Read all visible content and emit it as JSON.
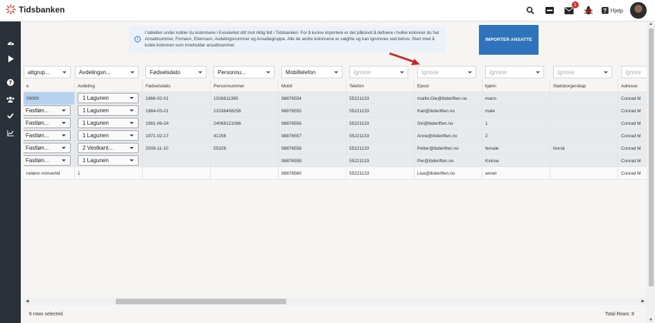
{
  "app": {
    "title": "Tidsbanken"
  },
  "topbar": {
    "help_label": "Hjelp",
    "mail_badge": "1"
  },
  "info": {
    "text": "I tabellen under kobler du kolonnene i Excelarket ditt mot riktig felt i Tidsbanken. For å kunne importere er det påkrevd å definere i hvilke kolonner du har Ansattnummer, Fornavn, Etternavn, Avdelingsnummer og Ansattegruppe. Alle de andre kolonnene er valgfrie og kan ignoreres ved behov. Start med å koble kolonnen som inneholder ansattnummer."
  },
  "import_button": {
    "label": "IMPORTER ANSATTE"
  },
  "column_selects": [
    {
      "label": "attgrup..."
    },
    {
      "label": "Avdelingsn..."
    },
    {
      "label": "Fødselsdato"
    },
    {
      "label": "Personnu..."
    },
    {
      "label": "Mobiltelefon"
    },
    {
      "label": "Ignorer"
    },
    {
      "label": "Ignorer"
    },
    {
      "label": "Ignorer"
    },
    {
      "label": "Ignorer"
    },
    {
      "label": "Ignore"
    }
  ],
  "headers": [
    "e",
    "Avdeling",
    "Fødselsdato",
    "Personnummer",
    "Mobil",
    "Telefon",
    "Epost",
    "kjønn",
    "Statsborgerskap",
    "Adresse"
  ],
  "rows": [
    {
      "c0": "00000",
      "c1": "",
      "c2": "1966-02-01",
      "c3": "1026611365",
      "c4": "98876554",
      "c5": "55221133",
      "c6": "mailto:Ole@ibderiften.no",
      "c7": "mann",
      "c8": "",
      "c9": "Conrad M"
    },
    {
      "c0": "Fastløn...",
      "c1": "1 Lagunen",
      "c2": "1984-03-21",
      "c3": "21038408256",
      "c4": "98876555",
      "c5": "55221133",
      "c6": "Kari@ibderiften.no",
      "c7": "male",
      "c8": "",
      "c9": "Conrad M"
    },
    {
      "c0": "Fastløn...",
      "c1": "1 Lagunen",
      "c2": "1981-06-24",
      "c3": "24068121066",
      "c4": "98876556",
      "c5": "55221133",
      "c6": "Siri@ibderiften.no",
      "c7": "1",
      "c8": "",
      "c9": "Conrad M"
    },
    {
      "c0": "Fastløn...",
      "c1": "1 Lagunen",
      "c2": "1971-02-17",
      "c3": "41256",
      "c4": "98876557",
      "c5": "55221133",
      "c6": "Anne@ibderiften.no",
      "c7": "2",
      "c8": "",
      "c9": "Conrad M"
    },
    {
      "c0": "Fastløn...",
      "c1": "2 Vestkant...",
      "c2": "2009-11-10",
      "c3": "55326",
      "c4": "98876558",
      "c5": "55221133",
      "c6": "Petter@ibderiften.no",
      "c7": "female",
      "c8": "Norsk",
      "c9": "Conrad M"
    },
    {
      "c0": "Fastløn...",
      "c1": "1 Lagunen",
      "c2": "",
      "c3": "",
      "c4": "98876559",
      "c5": "55221133",
      "c6": "Per@ibderiften.no",
      "c7": "Kvinne",
      "c8": "",
      "c9": "Conrad M"
    },
    {
      "c0": "nelønn m/overtid",
      "c1": "1",
      "c2": "",
      "c3": "",
      "c4": "98876560",
      "c5": "55221133",
      "c6": "Lise@ibderiften.no",
      "c7": "annet",
      "c8": "",
      "c9": "Conrad M"
    }
  ],
  "row0_dept_select": "1 Lagunen",
  "footer": {
    "selected": "6 rows selected",
    "total": "Total Rows: 8"
  },
  "colors": {
    "primary": "#2f73bd",
    "sidebar": "#2b3138",
    "accent_red": "#d32f2f"
  }
}
